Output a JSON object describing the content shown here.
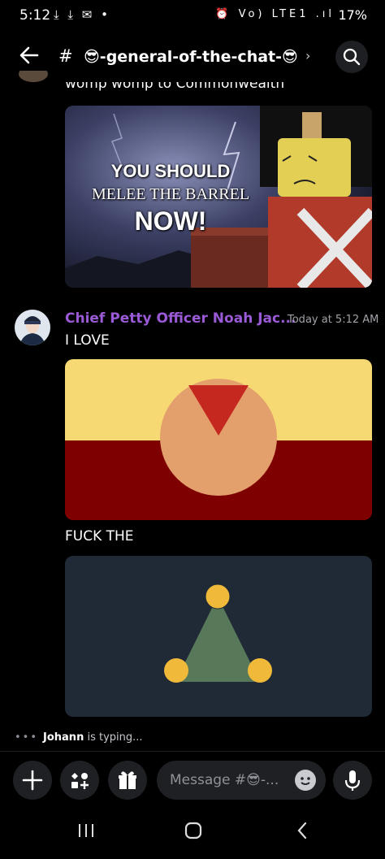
{
  "status_bar": {
    "time": "5:12",
    "left_icons": "⤓ ⤓ ✉ •",
    "right_icons": "⏰ Vo) LTE1 .ıl",
    "battery": "17%"
  },
  "header": {
    "hash": "#",
    "channel_name": "😎-general-of-the-chat-😎",
    "chevron": "›"
  },
  "previous_message": {
    "text": "womp womp to Commonwealth",
    "image": {
      "line1": "YOU SHOULD",
      "line2": "MELEE THE BARREL",
      "line3": "NOW!"
    }
  },
  "message": {
    "author": "Chief Petty Officer Noah Jac...",
    "timestamp": "Today at 5:12 AM",
    "line1": "I LOVE",
    "line2": "FUCK THE"
  },
  "typing": {
    "user": "Johann",
    "suffix": " is typing..."
  },
  "composer": {
    "placeholder": "Message #😎-..."
  },
  "colors": {
    "author": "#9a5ad6",
    "flag1_top": "#f7d974",
    "flag1_bottom": "#7f0000",
    "flag1_circle": "#e3a06c",
    "flag1_triangle": "#c4281e",
    "flag2_bg": "#1f2a36",
    "flag2_triangle": "#58785a",
    "flag2_dots": "#f1b93a"
  },
  "icons": {
    "back": "arrow-left-icon",
    "search": "search-icon",
    "plus": "plus-icon",
    "apps": "apps-icon",
    "gift": "gift-icon",
    "emoji": "emoji-icon",
    "mic": "microphone-icon",
    "nav_recents": "recents-icon",
    "nav_home": "home-icon",
    "nav_back": "nav-back-icon"
  }
}
